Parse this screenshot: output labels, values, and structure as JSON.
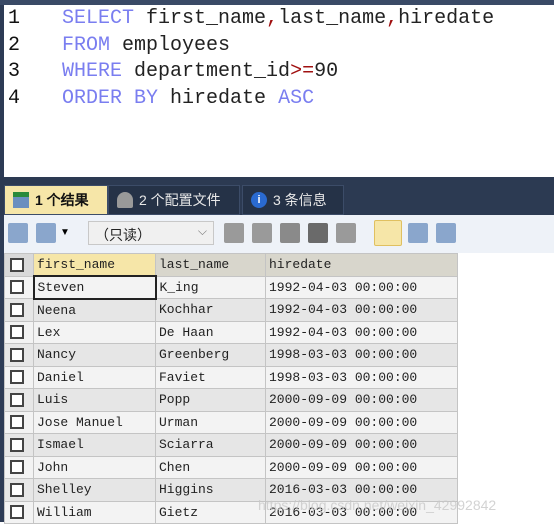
{
  "editor": {
    "lines": [
      {
        "n": "1",
        "parts": [
          [
            "kw",
            "SELECT"
          ],
          [
            "",
            "first_name"
          ],
          [
            "op",
            ","
          ],
          [
            "",
            "last_name"
          ],
          [
            "op",
            ","
          ],
          [
            "",
            "hiredate"
          ]
        ]
      },
      {
        "n": "2",
        "parts": [
          [
            "kw",
            "FROM"
          ],
          [
            "",
            "employees"
          ]
        ]
      },
      {
        "n": "3",
        "parts": [
          [
            "kw",
            "WHERE"
          ],
          [
            "",
            "department_id"
          ],
          [
            "op",
            ">="
          ],
          [
            "",
            "90"
          ]
        ]
      },
      {
        "n": "4",
        "parts": [
          [
            "kw",
            "ORDER BY"
          ],
          [
            "",
            "hiredate"
          ],
          [
            "kw",
            "ASC"
          ]
        ]
      }
    ]
  },
  "tabs": [
    {
      "label": "1 个结果",
      "icon": "result-grid-icon"
    },
    {
      "label": "2 个配置文件",
      "icon": "profile-icon"
    },
    {
      "label": "3 条信息",
      "icon": "info-icon"
    }
  ],
  "toolbar": {
    "mode": "（只读）"
  },
  "grid": {
    "columns": [
      "first_name",
      "last_name",
      "hiredate"
    ],
    "rows": [
      [
        "Steven",
        "K_ing",
        "1992-04-03 00:00:00"
      ],
      [
        "Neena",
        "Kochhar",
        "1992-04-03 00:00:00"
      ],
      [
        "Lex",
        "De Haan",
        "1992-04-03 00:00:00"
      ],
      [
        "Nancy",
        "Greenberg",
        "1998-03-03 00:00:00"
      ],
      [
        "Daniel",
        "Faviet",
        "1998-03-03 00:00:00"
      ],
      [
        "Luis",
        "Popp",
        "2000-09-09 00:00:00"
      ],
      [
        "Jose Manuel",
        "Urman",
        "2000-09-09 00:00:00"
      ],
      [
        "Ismael",
        "Sciarra",
        "2000-09-09 00:00:00"
      ],
      [
        "John",
        "Chen",
        "2000-09-09 00:00:00"
      ],
      [
        "Shelley",
        "Higgins",
        "2016-03-03 00:00:00"
      ],
      [
        "William",
        "Gietz",
        "2016-03-03 00:00:00"
      ]
    ]
  },
  "watermark": "https://blog.csdn.net/weixin_42992842"
}
